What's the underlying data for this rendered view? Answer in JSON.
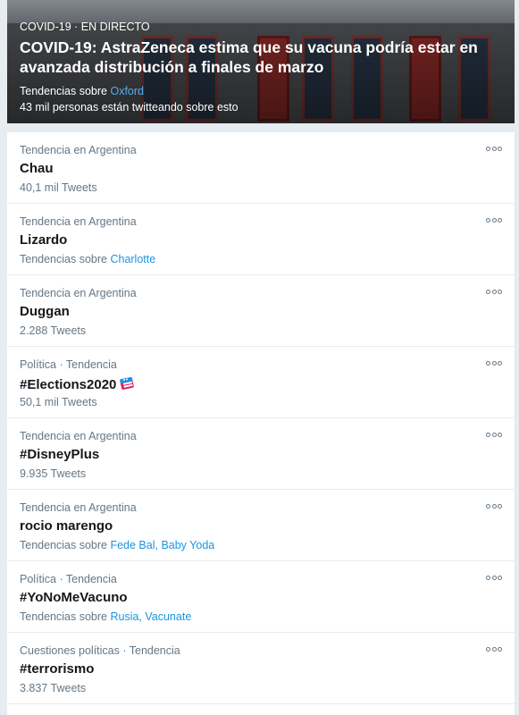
{
  "hero": {
    "context": "COVID-19 · EN DIRECTO",
    "title": "COVID-19: AstraZeneca estima que su vacuna podría estar en avanzada distribución a finales de marzo",
    "trending_prefix": "Tendencias sobre",
    "trending_link": "Oxford",
    "count_text": "43 mil personas están twitteando sobre esto"
  },
  "trends": [
    {
      "context": "Tendencia en Argentina",
      "name": "Chau",
      "meta": "40,1 mil Tweets"
    },
    {
      "context": "Tendencia en Argentina",
      "name": "Lizardo",
      "meta_prefix": "Tendencias sobre",
      "meta_links": "Charlotte"
    },
    {
      "context": "Tendencia en Argentina",
      "name": "Duggan",
      "meta": "2.288 Tweets"
    },
    {
      "context": "Política · Tendencia",
      "name": "#Elections2020",
      "meta": "50,1 mil Tweets",
      "hashflag_icon": "ballot-box-icon"
    },
    {
      "context": "Tendencia en Argentina",
      "name": "#DisneyPlus",
      "meta": "9.935 Tweets"
    },
    {
      "context": "Tendencia en Argentina",
      "name": "rocio marengo",
      "meta_prefix": "Tendencias sobre",
      "meta_links": "Fede Bal, Baby Yoda"
    },
    {
      "context": "Política · Tendencia",
      "name": "#YoNoMeVacuno",
      "meta_prefix": "Tendencias sobre",
      "meta_links": "Rusia, Vacunate"
    },
    {
      "context": "Cuestiones políticas · Tendencia",
      "name": "#terrorismo",
      "meta": "3.837 Tweets"
    }
  ],
  "colors": {
    "accent_link": "#1b95e0",
    "secondary_text": "#657786",
    "primary_text": "#14171a",
    "background": "#e6ecf0"
  }
}
